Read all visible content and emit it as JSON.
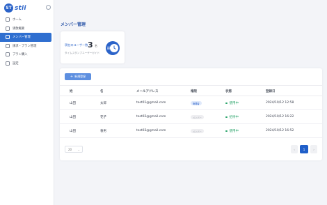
{
  "brand": {
    "mark": "ST",
    "name": "stii"
  },
  "nav": [
    {
      "label": "ホーム",
      "icon": "home-icon",
      "active": false
    },
    {
      "label": "请款概要",
      "icon": "inbox-icon",
      "active": false
    },
    {
      "label": "メンバー管理",
      "icon": "users-icon",
      "active": true
    },
    {
      "label": "請求・プラン管理",
      "icon": "document-icon",
      "active": false
    },
    {
      "label": "プラン購入",
      "icon": "cart-icon",
      "active": false
    },
    {
      "label": "設定",
      "icon": "gear-icon",
      "active": false
    }
  ],
  "page": {
    "title": "メンバー管理"
  },
  "card": {
    "label": "現在のユーザー数",
    "count": "3",
    "unit": "名",
    "sub": "タイムスタンプユーザーガイド"
  },
  "toolbar": {
    "new_label": "新規登録",
    "new_icon": "plus-icon"
  },
  "table": {
    "headers": [
      "姓",
      "名",
      "メールアドレス",
      "権限",
      "状態",
      "登録日"
    ],
    "rows": [
      {
        "last": "山田",
        "first": "太郎",
        "email": "test01@gmail.com",
        "role": "管理者",
        "status": "使用中",
        "date": "2024/10/12 12:58"
      },
      {
        "last": "山田",
        "first": "花子",
        "email": "test02@gmail.com",
        "role": "メンバー",
        "status": "招待中",
        "date": "2024/10/12 16:22"
      },
      {
        "last": "山田",
        "first": "春男",
        "email": "test03@gmail.com",
        "role": "メンバー",
        "status": "使用中",
        "date": "2024/10/12 16:52"
      }
    ]
  },
  "pagination": {
    "per_page": "20",
    "prev": "‹",
    "current": "1",
    "next": "›"
  },
  "colors": {
    "accent": "#2f6fd0",
    "status_active": "#2aa46b",
    "admin_badge": "#dfe9fb"
  }
}
